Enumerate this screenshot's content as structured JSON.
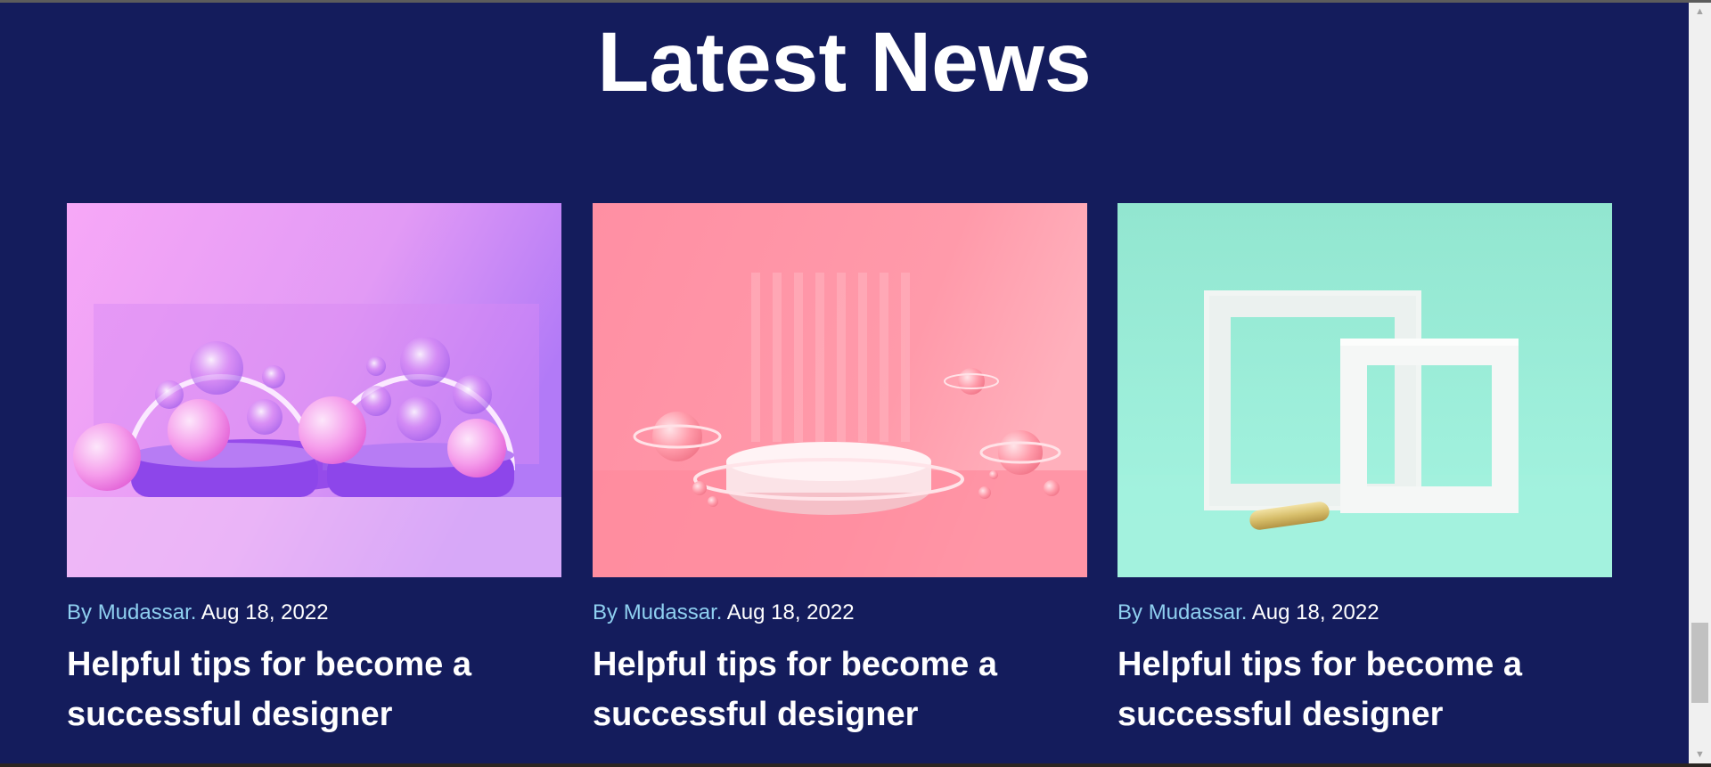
{
  "section": {
    "title": "Latest News"
  },
  "cards": [
    {
      "author_prefix": "By ",
      "author": "Mudassar.",
      "date": " Aug 18, 2022",
      "title": "Helpful tips for become a successful designer",
      "image": "purple-glass-spheres-scene"
    },
    {
      "author_prefix": "By ",
      "author": "Mudassar.",
      "date": " Aug 18, 2022",
      "title": "Helpful tips for become a successful designer",
      "image": "pink-podium-scene"
    },
    {
      "author_prefix": "By ",
      "author": "Mudassar.",
      "date": " Aug 18, 2022",
      "title": "Helpful tips for become a successful designer",
      "image": "mint-frames-scene"
    }
  ],
  "colors": {
    "background": "#141c5c",
    "author": "#8fd0f0",
    "title": "#ffffff"
  },
  "scrollbar": {
    "up_icon": "arrow-up-icon",
    "down_icon": "arrow-down-icon"
  }
}
